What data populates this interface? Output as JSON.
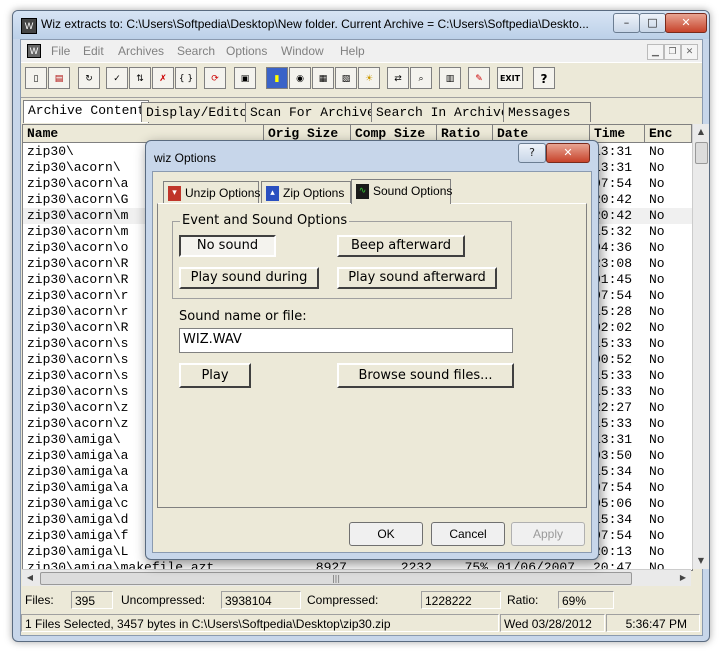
{
  "window": {
    "title": "Wiz extracts to: C:\\Users\\Softpedia\\Desktop\\New folder. Current Archive = C:\\Users\\Softpedia\\Deskto...",
    "minimize": "–",
    "maximize": "□",
    "close": "✕"
  },
  "menu": [
    "File",
    "Edit",
    "Archives",
    "Search",
    "Options",
    "Window",
    "Help"
  ],
  "toolbar_icons": [
    "new-file-icon",
    "open-archive-icon",
    "refresh-icon",
    "extract-icon",
    "extract-all-icon",
    "delete-icon",
    "brackets-icon",
    "reload-icon",
    "archive-icon",
    "find-icon",
    "view-icon",
    "print-icon",
    "info-icon",
    "tip-icon",
    "transfer-icon",
    "search-icon",
    "trash-icon",
    "edit-icon",
    "exit-icon",
    "help-icon"
  ],
  "toolbar_labels": {
    "brackets": "{ }",
    "exit": "EXIT",
    "help": "?"
  },
  "tabs": [
    "Archive Contents",
    "Display/Editor",
    "Scan For Archives",
    "Search In Archives",
    "Messages"
  ],
  "columns": [
    "Name",
    "Orig Size",
    "Comp Size",
    "Ratio",
    "Date",
    "Time",
    "Enc"
  ],
  "rows": [
    {
      "name": "zip30\\",
      "time": "13:31",
      "enc": "No"
    },
    {
      "name": "zip30\\acorn\\",
      "time": "13:31",
      "enc": "No"
    },
    {
      "name": "zip30\\acorn\\a",
      "time": "07:54",
      "enc": "No"
    },
    {
      "name": "zip30\\acorn\\G",
      "time": "20:42",
      "enc": "No"
    },
    {
      "name": "zip30\\acorn\\m",
      "time": "20:42",
      "enc": "No",
      "selected": true
    },
    {
      "name": "zip30\\acorn\\m",
      "time": "15:32",
      "enc": "No"
    },
    {
      "name": "zip30\\acorn\\o",
      "time": "04:36",
      "enc": "No"
    },
    {
      "name": "zip30\\acorn\\R",
      "time": "23:08",
      "enc": "No"
    },
    {
      "name": "zip30\\acorn\\R",
      "time": "01:45",
      "enc": "No"
    },
    {
      "name": "zip30\\acorn\\r",
      "time": "07:54",
      "enc": "No"
    },
    {
      "name": "zip30\\acorn\\r",
      "time": "15:28",
      "enc": "No"
    },
    {
      "name": "zip30\\acorn\\R",
      "time": "02:02",
      "enc": "No"
    },
    {
      "name": "zip30\\acorn\\s",
      "time": "15:33",
      "enc": "No"
    },
    {
      "name": "zip30\\acorn\\s",
      "time": "00:52",
      "enc": "No"
    },
    {
      "name": "zip30\\acorn\\s",
      "time": "15:33",
      "enc": "No"
    },
    {
      "name": "zip30\\acorn\\s",
      "time": "15:33",
      "enc": "No"
    },
    {
      "name": "zip30\\acorn\\z",
      "time": "22:27",
      "enc": "No"
    },
    {
      "name": "zip30\\acorn\\z",
      "time": "15:33",
      "enc": "No"
    },
    {
      "name": "zip30\\amiga\\",
      "time": "13:31",
      "enc": "No"
    },
    {
      "name": "zip30\\amiga\\a",
      "time": "03:50",
      "enc": "No"
    },
    {
      "name": "zip30\\amiga\\a",
      "time": "15:34",
      "enc": "No"
    },
    {
      "name": "zip30\\amiga\\a",
      "time": "07:54",
      "enc": "No"
    },
    {
      "name": "zip30\\amiga\\c",
      "time": "05:06",
      "enc": "No"
    },
    {
      "name": "zip30\\amiga\\d",
      "time": "15:34",
      "enc": "No"
    },
    {
      "name": "zip30\\amiga\\f",
      "time": "07:54",
      "enc": "No"
    },
    {
      "name": "zip30\\amiga\\L",
      "time": "20:13",
      "enc": "No"
    },
    {
      "name": "zip30\\amiga\\makefile.azt",
      "orig": "8927",
      "comp": "2232",
      "ratio": "75%",
      "date": "01/06/2007",
      "time": "20:47",
      "enc": "No"
    }
  ],
  "status": {
    "files_label": "Files:",
    "files_value": "395",
    "uncompressed_label": "Uncompressed:",
    "uncompressed_value": "3938104",
    "compressed_label": "Compressed:",
    "compressed_value": "1228222",
    "ratio_label": "Ratio:",
    "ratio_value": "69%",
    "selection": "1 Files Selected, 3457 bytes in C:\\Users\\Softpedia\\Desktop\\zip30.zip",
    "date": "Wed 03/28/2012",
    "time": "5:36:47 PM"
  },
  "dialog": {
    "title": "wiz Options",
    "help_btn": "?",
    "close_btn": "✕",
    "tabs": [
      "Unzip Options",
      "Zip Options",
      "Sound Options"
    ],
    "group_title": "Event and Sound Options",
    "no_sound": "No sound",
    "beep_afterward": "Beep afterward",
    "play_during": "Play sound during",
    "play_afterward": "Play sound afterward",
    "sound_name_label": "Sound name or file:",
    "sound_file": "WIZ.WAV",
    "play": "Play",
    "browse": "Browse sound files...",
    "ok": "OK",
    "cancel": "Cancel",
    "apply": "Apply"
  },
  "colors": {
    "selection_row": "#f0f0f0",
    "title_gradient": "#c7d6ea",
    "close_red": "#c7432b"
  }
}
